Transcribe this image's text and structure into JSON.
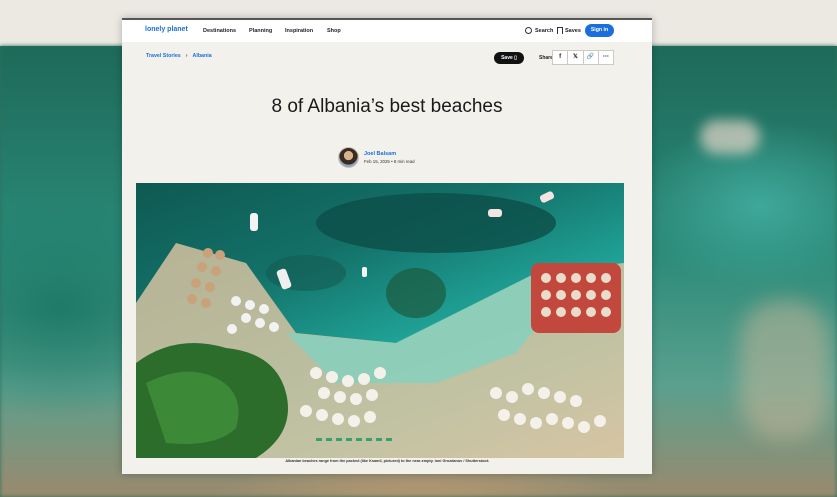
{
  "nav": {
    "logo": "lonely planet",
    "links": [
      "Destinations",
      "Planning",
      "Inspiration",
      "Shop"
    ],
    "search_label": "Search",
    "saves_label": "Saves",
    "signin_label": "Sign in"
  },
  "breadcrumb": {
    "items": [
      "Travel Stories",
      "Albania"
    ]
  },
  "toolbar": {
    "save_label": "Save",
    "share_label": "Share",
    "share_icons": [
      "f",
      "𝕏",
      "🔗",
      "⋯"
    ]
  },
  "article": {
    "title": "8 of Albania’s best beaches",
    "author": "Joel Balsam",
    "meta": "Feb 15, 2025 • 8 min read",
    "caption": "Albanian beaches range from the packed (like Ksamil, pictured) to the near-empty. Ioni Grozdanov / Shutterstock"
  }
}
